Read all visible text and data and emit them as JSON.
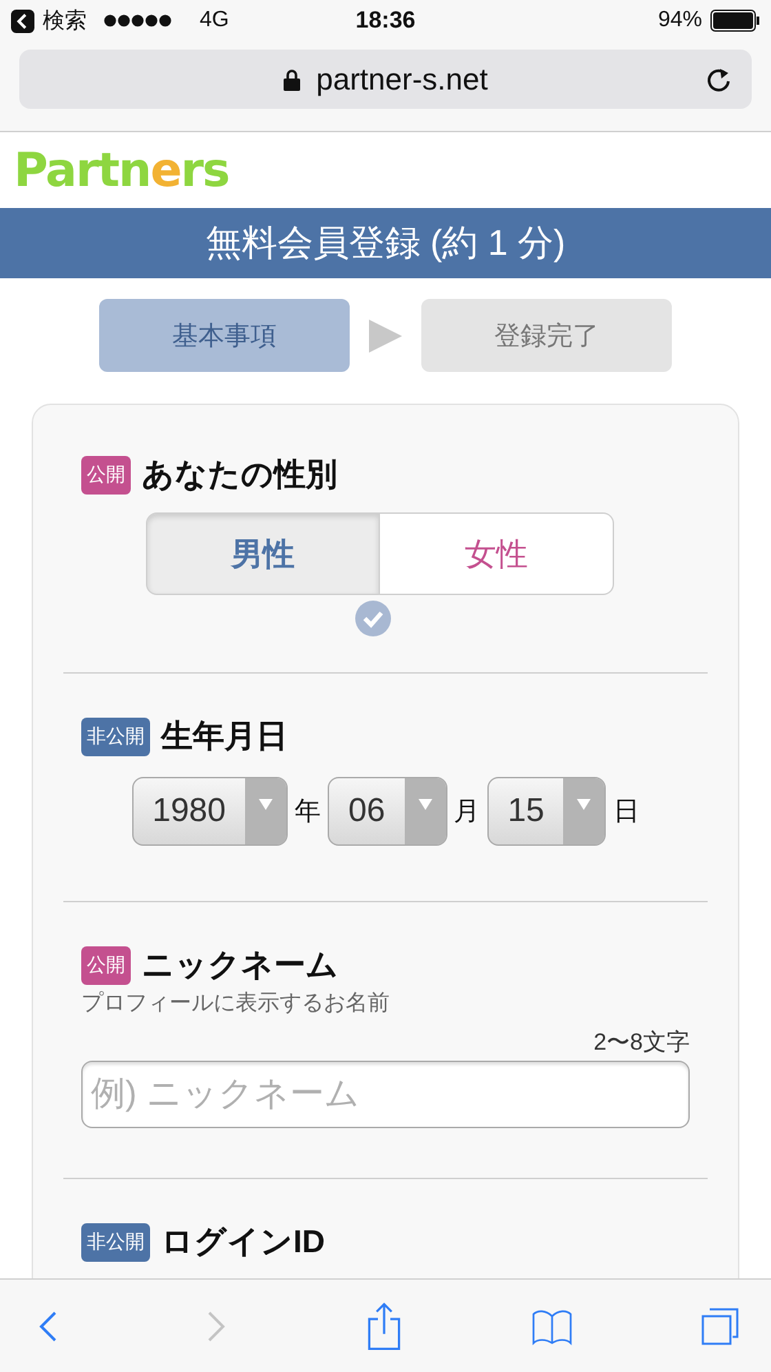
{
  "status_bar": {
    "back_label": "検索",
    "carrier": "4G",
    "time": "18:36",
    "battery": "94%"
  },
  "address_bar": {
    "url": "partner-s.net"
  },
  "logo": {
    "parts": [
      {
        "text": "Partn",
        "color": "#8ed640"
      },
      {
        "text": "e",
        "color": "#f2b233"
      },
      {
        "text": "rs",
        "color": "#8ed640"
      }
    ]
  },
  "header": {
    "title": "無料会員登録 (約 1 分)"
  },
  "steps": [
    {
      "label": "基本事項",
      "selected": true
    },
    {
      "label": "登録完了",
      "selected": false
    }
  ],
  "sections": [
    {
      "kind": "gender",
      "tag": {
        "label": "公開",
        "color": "#c4508f"
      },
      "title": "あなたの性別",
      "options": [
        {
          "label": "男性",
          "selected": true,
          "color": "#4d73a6"
        },
        {
          "label": "女性",
          "selected": false,
          "color": "#c4508f"
        }
      ]
    },
    {
      "kind": "date",
      "tag": {
        "label": "非公開",
        "color": "#4d73a6"
      },
      "title": "生年月日",
      "selects": [
        {
          "value": "1980",
          "unit": "年"
        },
        {
          "value": "06",
          "unit": "月"
        },
        {
          "value": "15",
          "unit": "日"
        }
      ]
    },
    {
      "kind": "text",
      "tag": {
        "label": "公開",
        "color": "#c4508f"
      },
      "title": "ニックネーム",
      "hint": "プロフィールに表示するお名前",
      "count": "2〜8文字",
      "placeholder": "例) ニックネーム"
    },
    {
      "kind": "heading",
      "tag": {
        "label": "非公開",
        "color": "#4d73a6"
      },
      "title": "ログインID"
    }
  ]
}
